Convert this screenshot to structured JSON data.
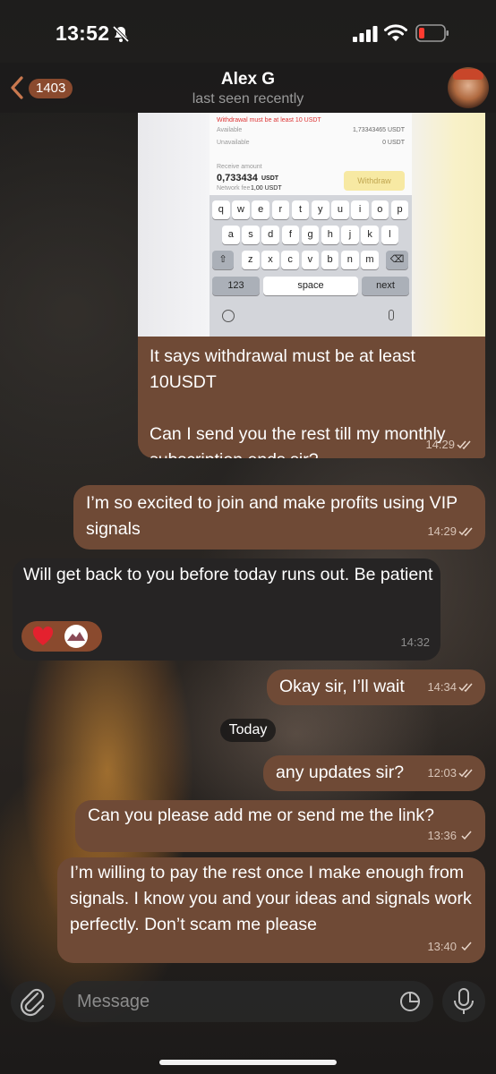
{
  "status_bar": {
    "time": "13:52"
  },
  "header": {
    "back_badge": "1403",
    "contact_name": "Alex G",
    "contact_status": "last seen recently"
  },
  "screenshot": {
    "available_label": "Available",
    "available_value": "1,73343465 USDT",
    "unavailable_label": "Unavailable",
    "unavailable_value": "0 USDT",
    "warning": "Withdrawal must be at least 10 USDT",
    "receive_label": "Receive amount",
    "receive_value": "0,733434",
    "receive_unit": "USDT",
    "fee_label": "Network fee",
    "fee_value": "1,00 USDT",
    "withdraw_button": "Withdraw",
    "keyboard_row1": [
      "q",
      "w",
      "e",
      "r",
      "t",
      "y",
      "u",
      "i",
      "o",
      "p"
    ],
    "keyboard_row2": [
      "a",
      "s",
      "d",
      "f",
      "g",
      "h",
      "j",
      "k",
      "l"
    ],
    "keyboard_row3": [
      "z",
      "x",
      "c",
      "v",
      "b",
      "n",
      "m"
    ],
    "key_123": "123",
    "key_space": "space",
    "key_next": "next"
  },
  "messages": [
    {
      "id": "m1",
      "direction": "out",
      "text": "It says withdrawal must be at least 10USDT\n\nCan I send you the rest till my monthly subscription ends sir?",
      "time": "14:29",
      "read": true
    },
    {
      "id": "m2",
      "direction": "out",
      "text": "I’m so excited to join and make profits using VIP signals",
      "time": "14:29",
      "read": true
    },
    {
      "id": "m3",
      "direction": "in",
      "text": "Will get back to you before today runs out. Be patient",
      "time": "14:32"
    },
    {
      "id": "m4",
      "direction": "out",
      "text": "Okay sir, I’ll wait",
      "time": "14:34",
      "read": true
    },
    {
      "id": "m5",
      "direction": "out",
      "text": "any updates sir?",
      "time": "12:03",
      "read": true
    },
    {
      "id": "m6",
      "direction": "out",
      "text": "Can you please add me or send me the link?",
      "time": "13:36",
      "read": false
    },
    {
      "id": "m7",
      "direction": "out",
      "text": "I’m willing to pay the rest once I make enough from signals. I know you and your ideas and signals work perfectly. Don’t scam me please",
      "time": "13:40",
      "read": false
    }
  ],
  "date_separator": "Today",
  "input": {
    "placeholder": "Message"
  },
  "colors": {
    "outgoing_bubble": "#6f4a36",
    "incoming_bubble": "#262424",
    "accent": "#8a4a2e"
  },
  "icons": [
    "bell-off-icon",
    "signal-icon",
    "wifi-icon",
    "battery-icon",
    "back-chevron-icon",
    "heart-icon",
    "attach-icon",
    "sticker-icon",
    "mic-icon"
  ]
}
